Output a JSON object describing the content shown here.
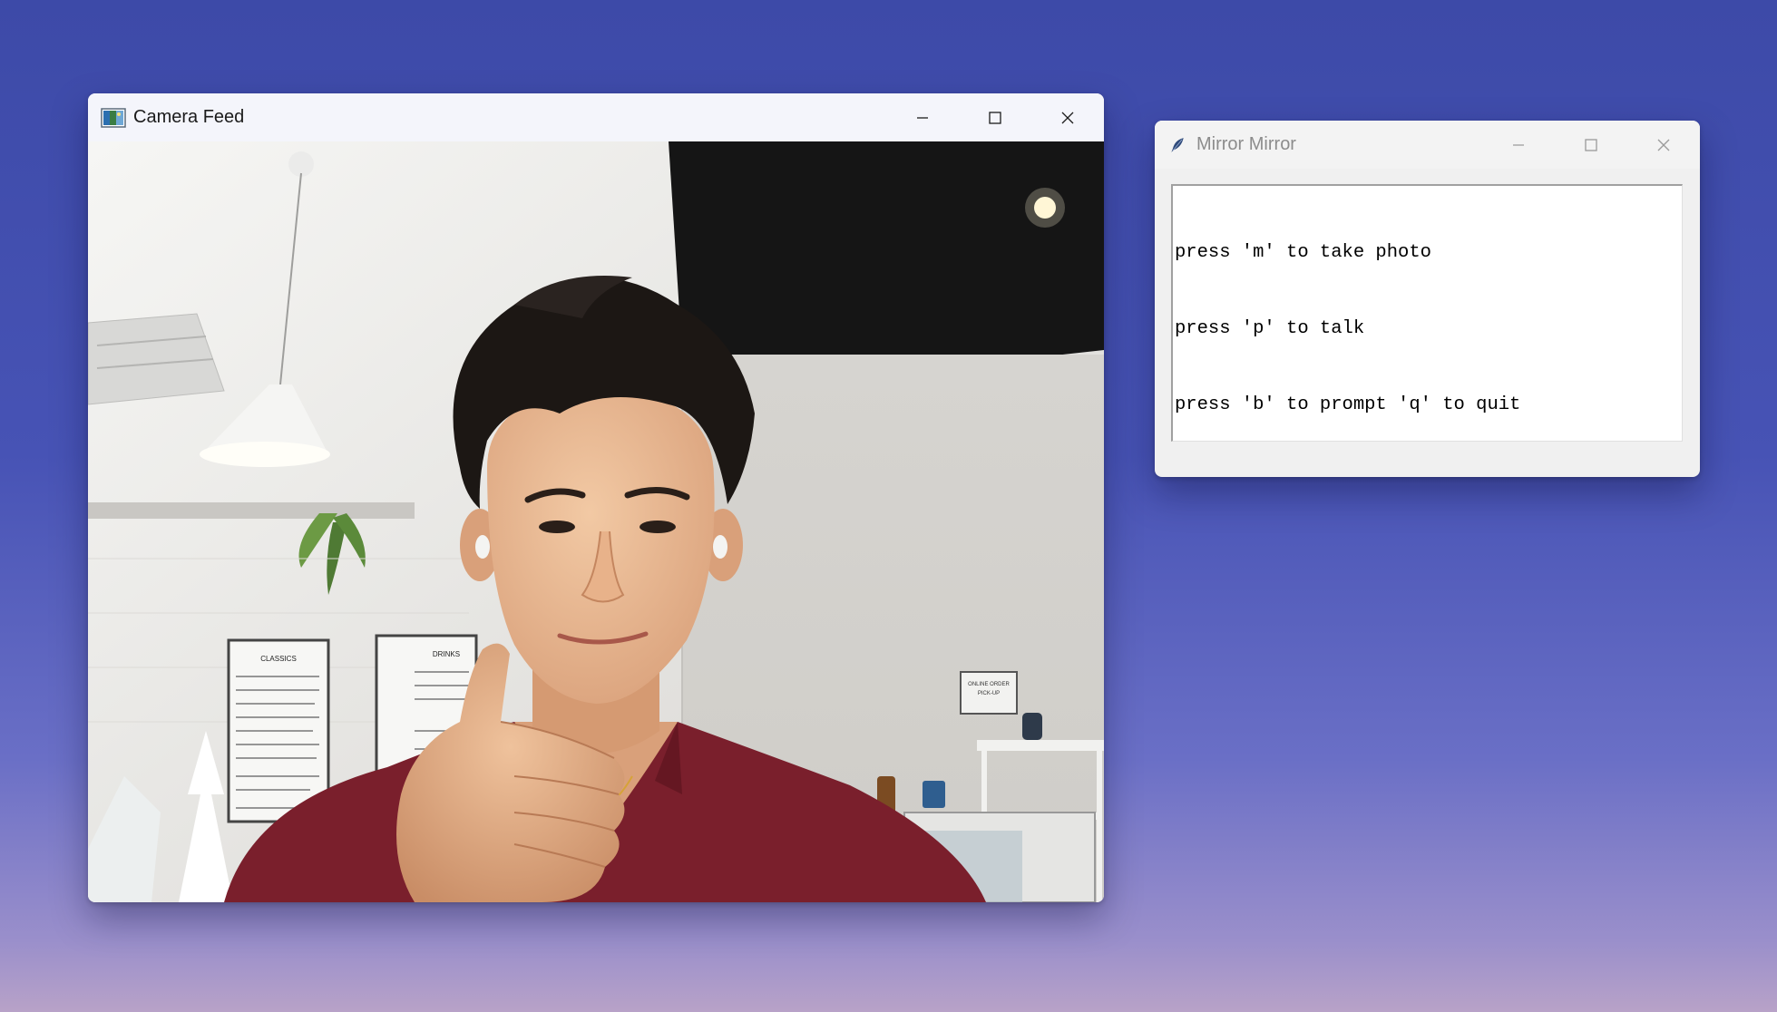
{
  "desktop": {
    "background_colors": [
      "#3d4aa8",
      "#6a6fc6",
      "#b8a2c8"
    ]
  },
  "camera_window": {
    "title": "Camera Feed",
    "icon": "image-app-icon",
    "controls": {
      "minimize": "minimize-icon",
      "maximize": "maximize-icon",
      "close": "close-icon"
    },
    "feed": {
      "subject": "person giving thumbs up in a cafe",
      "shirt_color": "#7a1f2c",
      "wall_color": "#d9d6d2",
      "ceiling_color": "#141414",
      "menu_board": {
        "heading_1": "CLASSICS",
        "heading_2": "DRINKS"
      },
      "sign": {
        "line_1": "ONLINE ORDER",
        "line_2": "PICK-UP"
      }
    }
  },
  "mirror_window": {
    "title": "Mirror Mirror",
    "icon": "feather-icon",
    "controls": {
      "minimize": "minimize-icon",
      "maximize": "maximize-icon",
      "close": "close-icon"
    },
    "text_lines": [
      "press 'm' to take photo",
      "press 'p' to talk",
      "press 'b' to prompt 'q' to quit"
    ]
  }
}
